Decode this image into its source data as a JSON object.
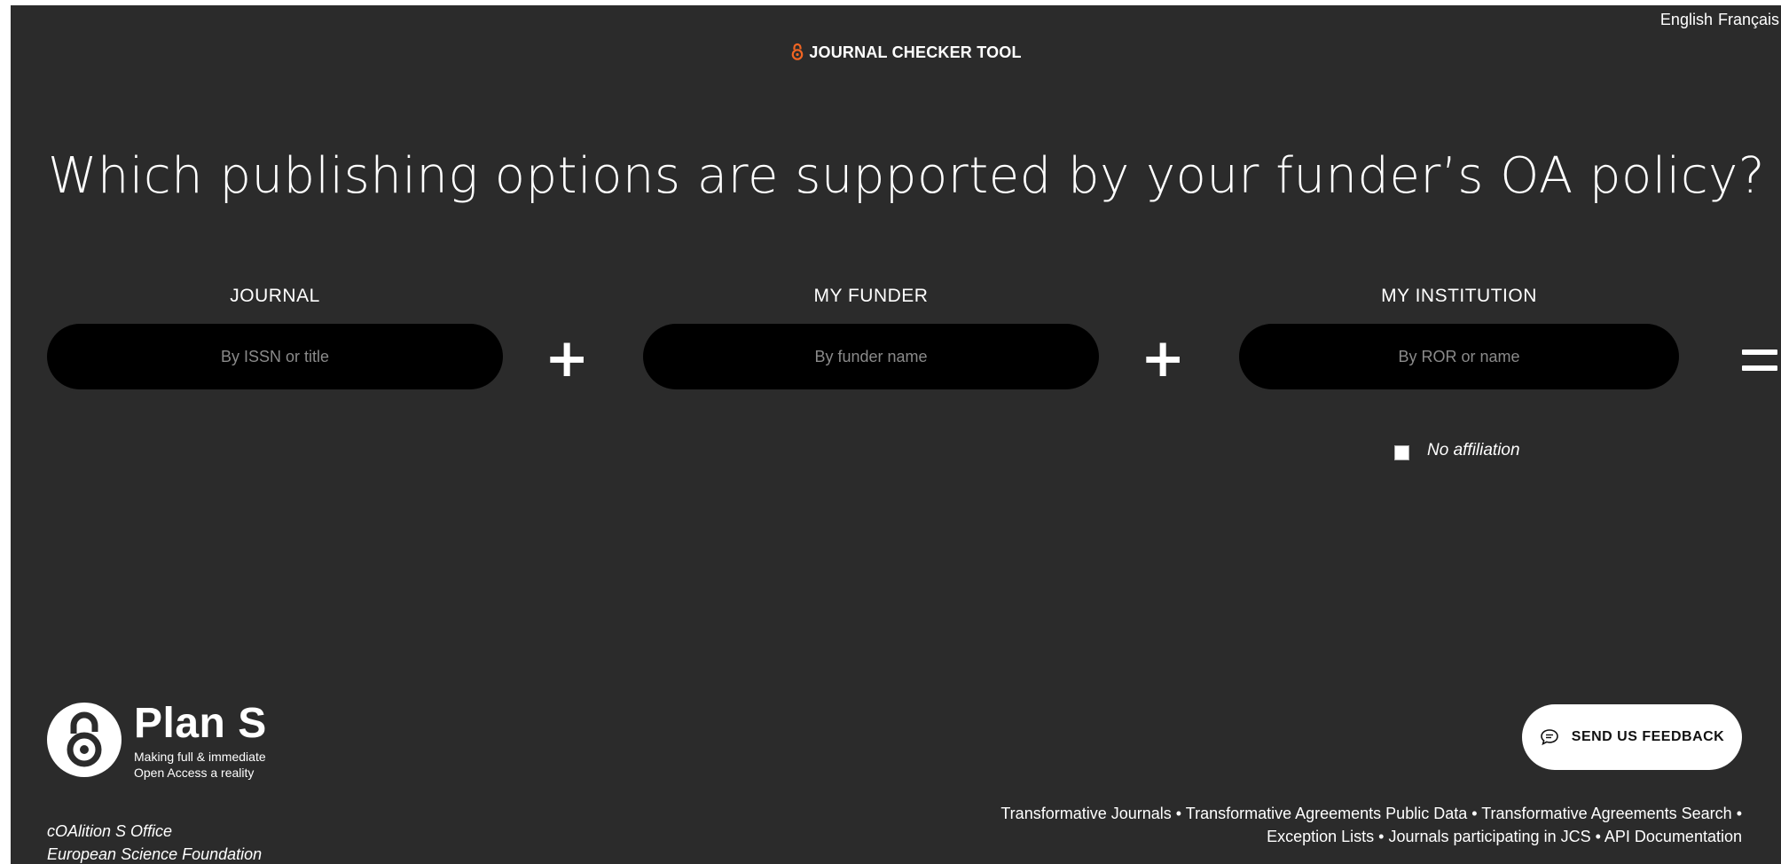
{
  "language": {
    "english": "English",
    "french": "Français"
  },
  "brand": {
    "title": "JOURNAL CHECKER TOOL",
    "accent_color": "#f26522",
    "icon": "open-access-lock-icon"
  },
  "headline": "Which publishing options are supported by your funder’s OA policy?",
  "fields": {
    "journal": {
      "label": "JOURNAL",
      "placeholder": "By ISSN or title",
      "value": ""
    },
    "funder": {
      "label": "MY FUNDER",
      "placeholder": "By funder name",
      "value": ""
    },
    "institution": {
      "label": "MY INSTITUTION",
      "placeholder": "By ROR or name",
      "value": ""
    }
  },
  "operators": {
    "plus": "+"
  },
  "no_affiliation": {
    "label": "No affiliation",
    "checked": false
  },
  "plan_s": {
    "title": "Plan S",
    "tagline_1": "Making full & immediate",
    "tagline_2": "Open Access a reality",
    "icon": "open-access-lock-icon"
  },
  "org": {
    "line1": "cOAlition S Office",
    "line2": "European Science Foundation"
  },
  "feedback": {
    "label": "SEND US FEEDBACK",
    "icon": "chat-bubble-icon"
  },
  "footer": {
    "separator": " • ",
    "links": [
      "Transformative Journals",
      "Transformative Agreements Public Data",
      "Transformative Agreements Search",
      "Exception Lists",
      "Journals participating in JCS",
      "API Documentation"
    ]
  },
  "colors": {
    "background": "#2b2b2b",
    "input_background": "#000000",
    "text": "#ffffff",
    "placeholder": "#8a8a8a"
  }
}
